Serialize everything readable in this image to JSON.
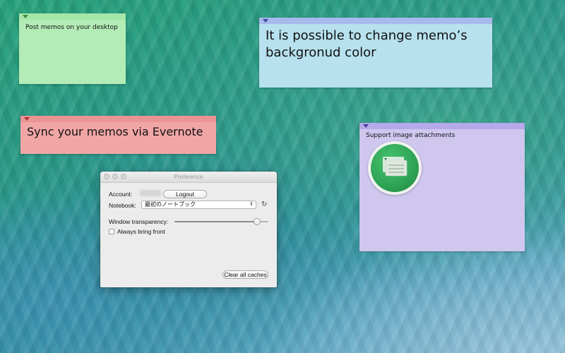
{
  "memos": {
    "green": {
      "text": "Post memos on your desktop",
      "color": "#b3ecb6"
    },
    "blue": {
      "text": "It is possible to change memo’s backgronud color",
      "color": "#b7e1ee"
    },
    "red": {
      "text": "Sync your memos via Evernote",
      "color": "#f1a6a6"
    },
    "purple": {
      "text": "Support image attachments",
      "color": "#cfc7ee"
    }
  },
  "preference": {
    "title": "Preference",
    "account_label": "Account:",
    "logout_label": "Logout",
    "notebook_label": "Notebook:",
    "notebook_value": "最初のノートブック",
    "refresh_icon": "↻",
    "window_transparency_label": "Window transparency:",
    "window_transparency_value": 0.88,
    "always_bring_front_label": "Always bring front",
    "always_bring_front_checked": false,
    "clear_caches_label": "Clear all caches"
  }
}
